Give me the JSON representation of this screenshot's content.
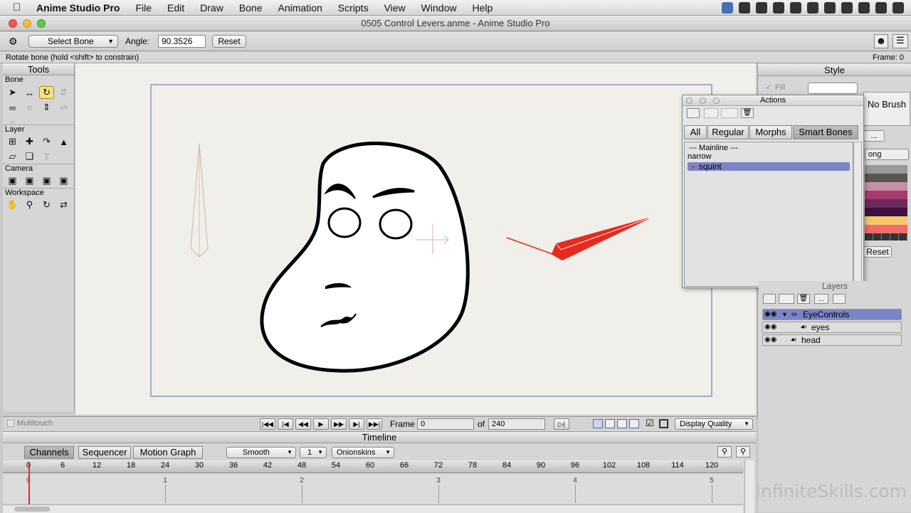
{
  "menubar": {
    "apple": "",
    "items": [
      "Anime Studio Pro",
      "File",
      "Edit",
      "Draw",
      "Bone",
      "Animation",
      "Scripts",
      "View",
      "Window",
      "Help"
    ]
  },
  "window": {
    "title": "0505 Control Levers.anme - Anime Studio Pro"
  },
  "tool_options": {
    "tool_select": "Select Bone",
    "angle_label": "Angle:",
    "angle_value": "90.3526",
    "reset_label": "Reset"
  },
  "status": {
    "hint": "Rotate bone (hold <shift> to constrain)",
    "frame": "Frame: 0"
  },
  "tools_panel": {
    "title": "Tools",
    "sections": [
      "Bone",
      "Layer",
      "Camera",
      "Workspace"
    ]
  },
  "style_panel": {
    "title": "Style",
    "fill_label": "Fill",
    "no_brush": "No Brush",
    "more": "...",
    "dropdown": "ong",
    "reset": "Reset"
  },
  "actions_panel": {
    "title": "Actions",
    "tabs": [
      "All",
      "Regular",
      "Morphs",
      "Smart Bones"
    ],
    "active_tab": "Smart Bones",
    "items": [
      "--- Mainline ---",
      "narrow",
      "squint"
    ],
    "selected": "squint"
  },
  "layers_panel": {
    "title": "Layers",
    "layers": [
      {
        "name": "EyeControls",
        "selected": true
      },
      {
        "name": "eyes",
        "selected": false
      },
      {
        "name": "head",
        "selected": false
      }
    ]
  },
  "playbar": {
    "multitouch": "Multitouch",
    "frame_label": "Frame",
    "frame_value": "0",
    "of_label": "of",
    "total_frames": "240",
    "display_quality": "Display Quality"
  },
  "timeline": {
    "title": "Timeline",
    "tabs": [
      "Channels",
      "Sequencer",
      "Motion Graph"
    ],
    "active_tab": "Channels",
    "interpolation": "Smooth",
    "step": "1",
    "onionskins": "Onionskins",
    "ruler_ticks": [
      "0",
      "6",
      "12",
      "18",
      "24",
      "30",
      "36",
      "42",
      "48",
      "54",
      "60",
      "66",
      "72",
      "78",
      "84",
      "90",
      "96",
      "102",
      "108",
      "114",
      "120"
    ],
    "seconds": [
      "0",
      "1",
      "2",
      "3",
      "4",
      "5"
    ]
  },
  "watermark": "InfiniteSkills.com",
  "colors": {
    "accent": "#7b84c7",
    "bone_red": "#e8291e",
    "highlight": "#f5e27a"
  }
}
